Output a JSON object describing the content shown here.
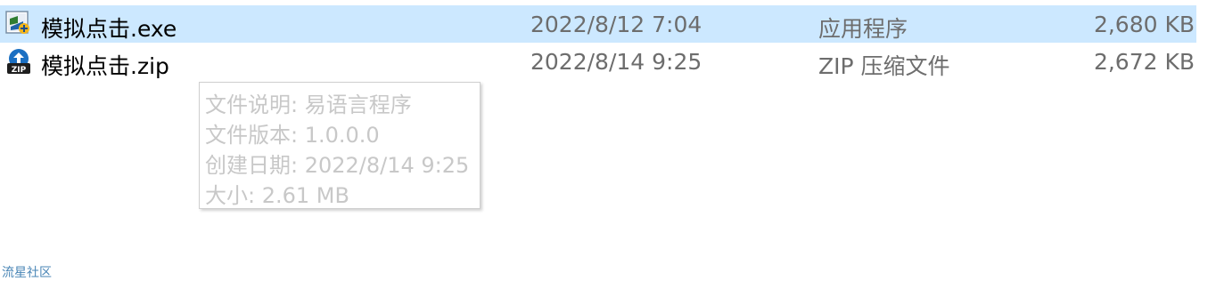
{
  "files": [
    {
      "name": "模拟点击.exe",
      "modified": "2022/8/12 7:04",
      "type": "应用程序",
      "size": "2,680 KB",
      "icon": "exe-app-icon",
      "selected": true
    },
    {
      "name": "模拟点击.zip",
      "modified": "2022/8/14 9:25",
      "type": "ZIP 压缩文件",
      "size": "2,672 KB",
      "icon": "zip-archive-icon",
      "selected": false
    }
  ],
  "tooltip": {
    "description": "文件说明: 易语言程序",
    "version": "文件版本: 1.0.0.0",
    "created": "创建日期: 2022/8/14 9:25",
    "size": "大小: 2.61 MB"
  },
  "watermark": "流星社区",
  "colors": {
    "selection": "#cce8ff",
    "secondary_text": "#6d6d6d",
    "tooltip_text": "#c8c8c8"
  }
}
